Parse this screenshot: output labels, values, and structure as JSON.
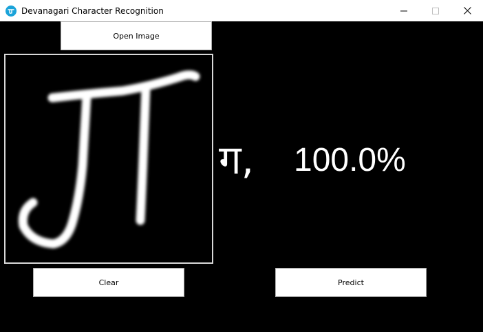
{
  "window": {
    "title": "Devanagari Character Recognition",
    "icon": "devanagari-app-icon",
    "controls": [
      "minimize-icon",
      "maximize-icon",
      "close-icon"
    ]
  },
  "buttons": {
    "open_image": "Open Image",
    "clear": "Clear",
    "predict": "Predict"
  },
  "canvas": {
    "content": "handwritten-character-ga"
  },
  "prediction": {
    "character": "ग,",
    "confidence": "100.0%"
  },
  "colors": {
    "background": "#000000",
    "titlebar": "#ffffff",
    "text_on_dark": "#ffffff",
    "icon_accent": "#1aa3d9"
  }
}
